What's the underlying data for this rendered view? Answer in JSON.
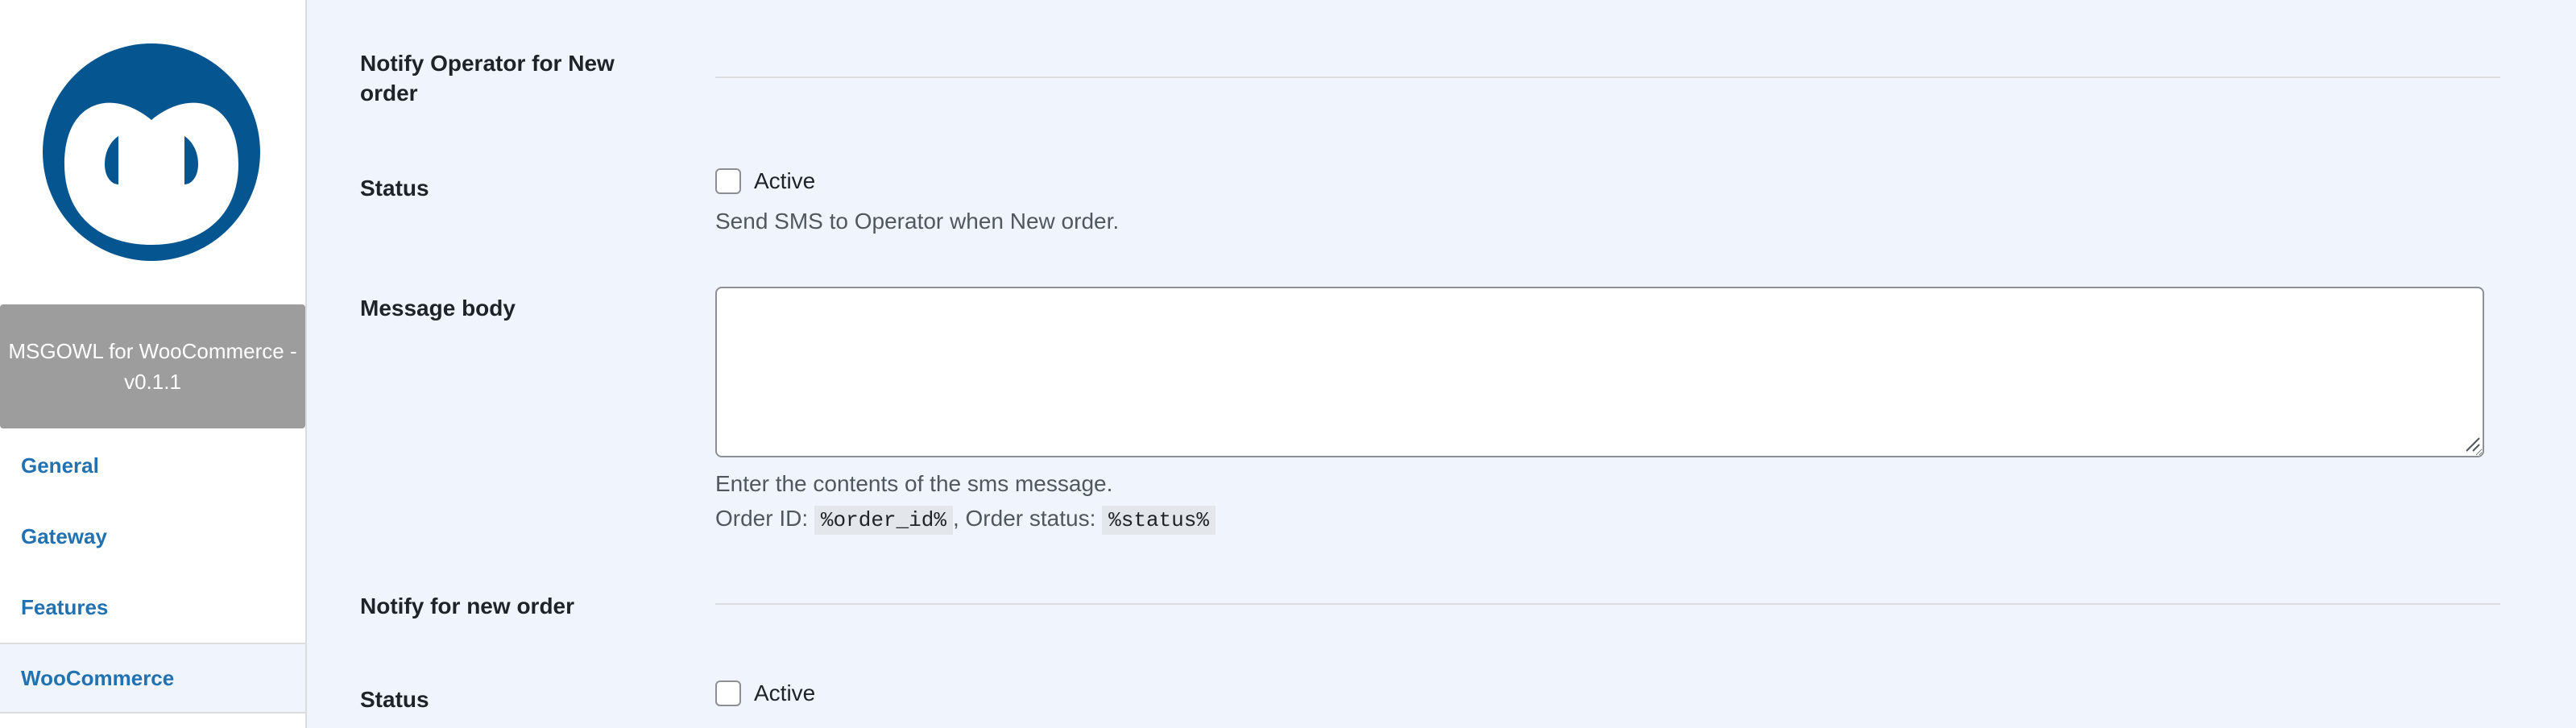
{
  "sidebar": {
    "logo_alt": "owl-logo-icon",
    "plugin_title": "MSGOWL for WooCommerce - v0.1.1",
    "nav": [
      {
        "label": "General"
      },
      {
        "label": "Gateway"
      },
      {
        "label": "Features"
      },
      {
        "label": "WooCommerce"
      }
    ]
  },
  "form": {
    "section_operator": {
      "title": "Notify Operator for New order"
    },
    "status_operator": {
      "label": "Status",
      "checkbox_label": "Active",
      "checked": false,
      "description": "Send SMS to Operator when New order."
    },
    "message_body": {
      "label": "Message body",
      "value": "",
      "help": "Enter the contents of the sms message.",
      "order_id_label": "Order ID:",
      "order_id_code": "%order_id%",
      "separator": ",",
      "order_status_label": "Order status:",
      "order_status_code": "%status%"
    },
    "section_new_order": {
      "title": "Notify for new order"
    },
    "status_new_order": {
      "label": "Status",
      "checkbox_label": "Active",
      "checked": false
    }
  },
  "colors": {
    "brand": "#055590",
    "link": "#2271b1",
    "page_bg": "#f0f4fc"
  }
}
